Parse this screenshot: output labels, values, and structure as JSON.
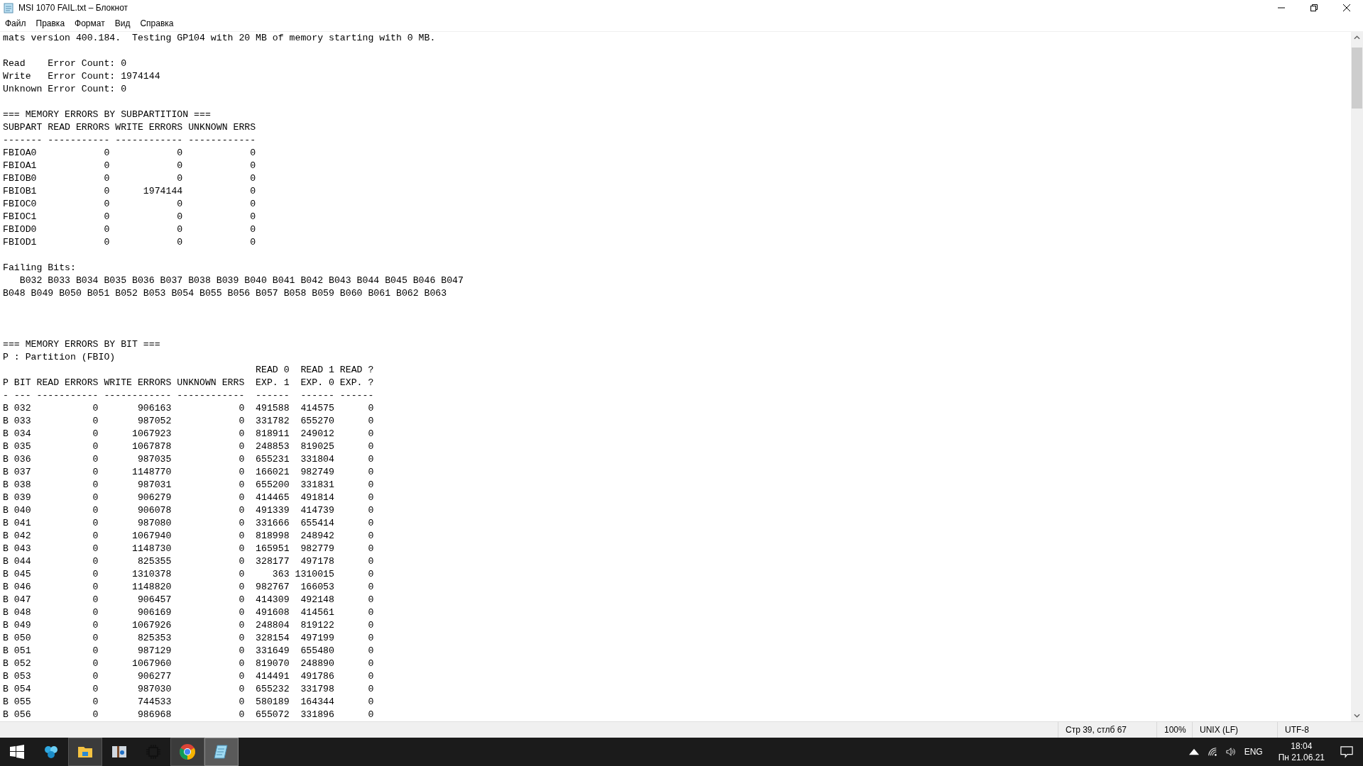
{
  "window": {
    "title": "MSI 1070 FAIL.txt – Блокнот"
  },
  "menu": [
    "Файл",
    "Правка",
    "Формат",
    "Вид",
    "Справка"
  ],
  "sections": [
    {
      "kind": "block",
      "lines": [
        "mats version 400.184.  Testing GP104 with 20 MB of memory starting with 0 MB."
      ]
    },
    {
      "kind": "block",
      "lines": [
        "Read    Error Count: 0",
        "Write   Error Count: 1974144",
        "Unknown Error Count: 0"
      ]
    },
    {
      "kind": "block",
      "lines": [
        "=== MEMORY ERRORS BY SUBPARTITION ===",
        "SUBPART READ ERRORS WRITE ERRORS UNKNOWN ERRS",
        "------- ----------- ------------ ------------",
        "FBIOA0            0            0            0",
        "FBIOA1            0            0            0",
        "FBIOB0            0            0            0",
        "FBIOB1            0      1974144            0",
        "FBIOC0            0            0            0",
        "FBIOC1            0            0            0",
        "FBIOD0            0            0            0",
        "FBIOD1            0            0            0"
      ]
    },
    {
      "kind": "block",
      "lines": [
        "Failing Bits:",
        "   B032 B033 B034 B035 B036 B037 B038 B039 B040 B041 B042 B043 B044 B045 B046 B047",
        "B048 B049 B050 B051 B052 B053 B054 B055 B056 B057 B058 B059 B060 B061 B062 B063"
      ]
    },
    {
      "kind": "wide-gap",
      "lines": [
        "=== MEMORY ERRORS BY BIT ===",
        "P : Partition (FBIO)",
        "                                             READ 0  READ 1 READ ?",
        "P BIT READ ERRORS WRITE ERRORS UNKNOWN ERRS  EXP. 1  EXP. 0 EXP. ?",
        "- --- ----------- ------------ ------------  ------  ------ ------",
        "B 032           0       906163            0  491588  414575      0",
        "B 033           0       987052            0  331782  655270      0",
        "B 034           0      1067923            0  818911  249012      0",
        "B 035           0      1067878            0  248853  819025      0",
        "B 036           0       987035            0  655231  331804      0",
        "B 037           0      1148770            0  166021  982749      0",
        "B 038           0       987031            0  655200  331831      0",
        "B 039           0       906279            0  414465  491814      0",
        "B 040           0       906078            0  491339  414739      0",
        "B 041           0       987080            0  331666  655414      0",
        "B 042           0      1067940            0  818998  248942      0",
        "B 043           0      1148730            0  165951  982779      0",
        "B 044           0       825355            0  328177  497178      0",
        "B 045           0      1310378            0     363 1310015      0",
        "B 046           0      1148820            0  982767  166053      0",
        "B 047           0       906457            0  414309  492148      0",
        "B 048           0       906169            0  491608  414561      0",
        "B 049           0      1067926            0  248804  819122      0",
        "B 050           0       825353            0  328154  497199      0",
        "B 051           0       987129            0  331649  655480      0",
        "B 052           0      1067960            0  819070  248890      0",
        "B 053           0       906277            0  414491  491786      0",
        "B 054           0       987030            0  655232  331798      0",
        "B 055           0       744533            0  580189  164344      0",
        "B 056           0       986968            0  655072  331896      0"
      ]
    }
  ],
  "status_bar": [
    "Стр 39, стлб 67",
    "100%",
    "UNIX (LF)",
    "UTF-8"
  ],
  "taskbar": {
    "apps": [
      {
        "kind": "people",
        "open": false,
        "selected": false
      },
      {
        "kind": "folder",
        "open": true,
        "selected": false
      },
      {
        "kind": "archive",
        "open": false,
        "selected": false
      },
      {
        "kind": "chip",
        "open": false,
        "selected": false
      },
      {
        "kind": "chrome",
        "open": true,
        "selected": false
      },
      {
        "kind": "notepad",
        "open": true,
        "selected": true
      }
    ],
    "language": "ENG",
    "time": "18:04",
    "date": "Пн 21.06.21"
  }
}
